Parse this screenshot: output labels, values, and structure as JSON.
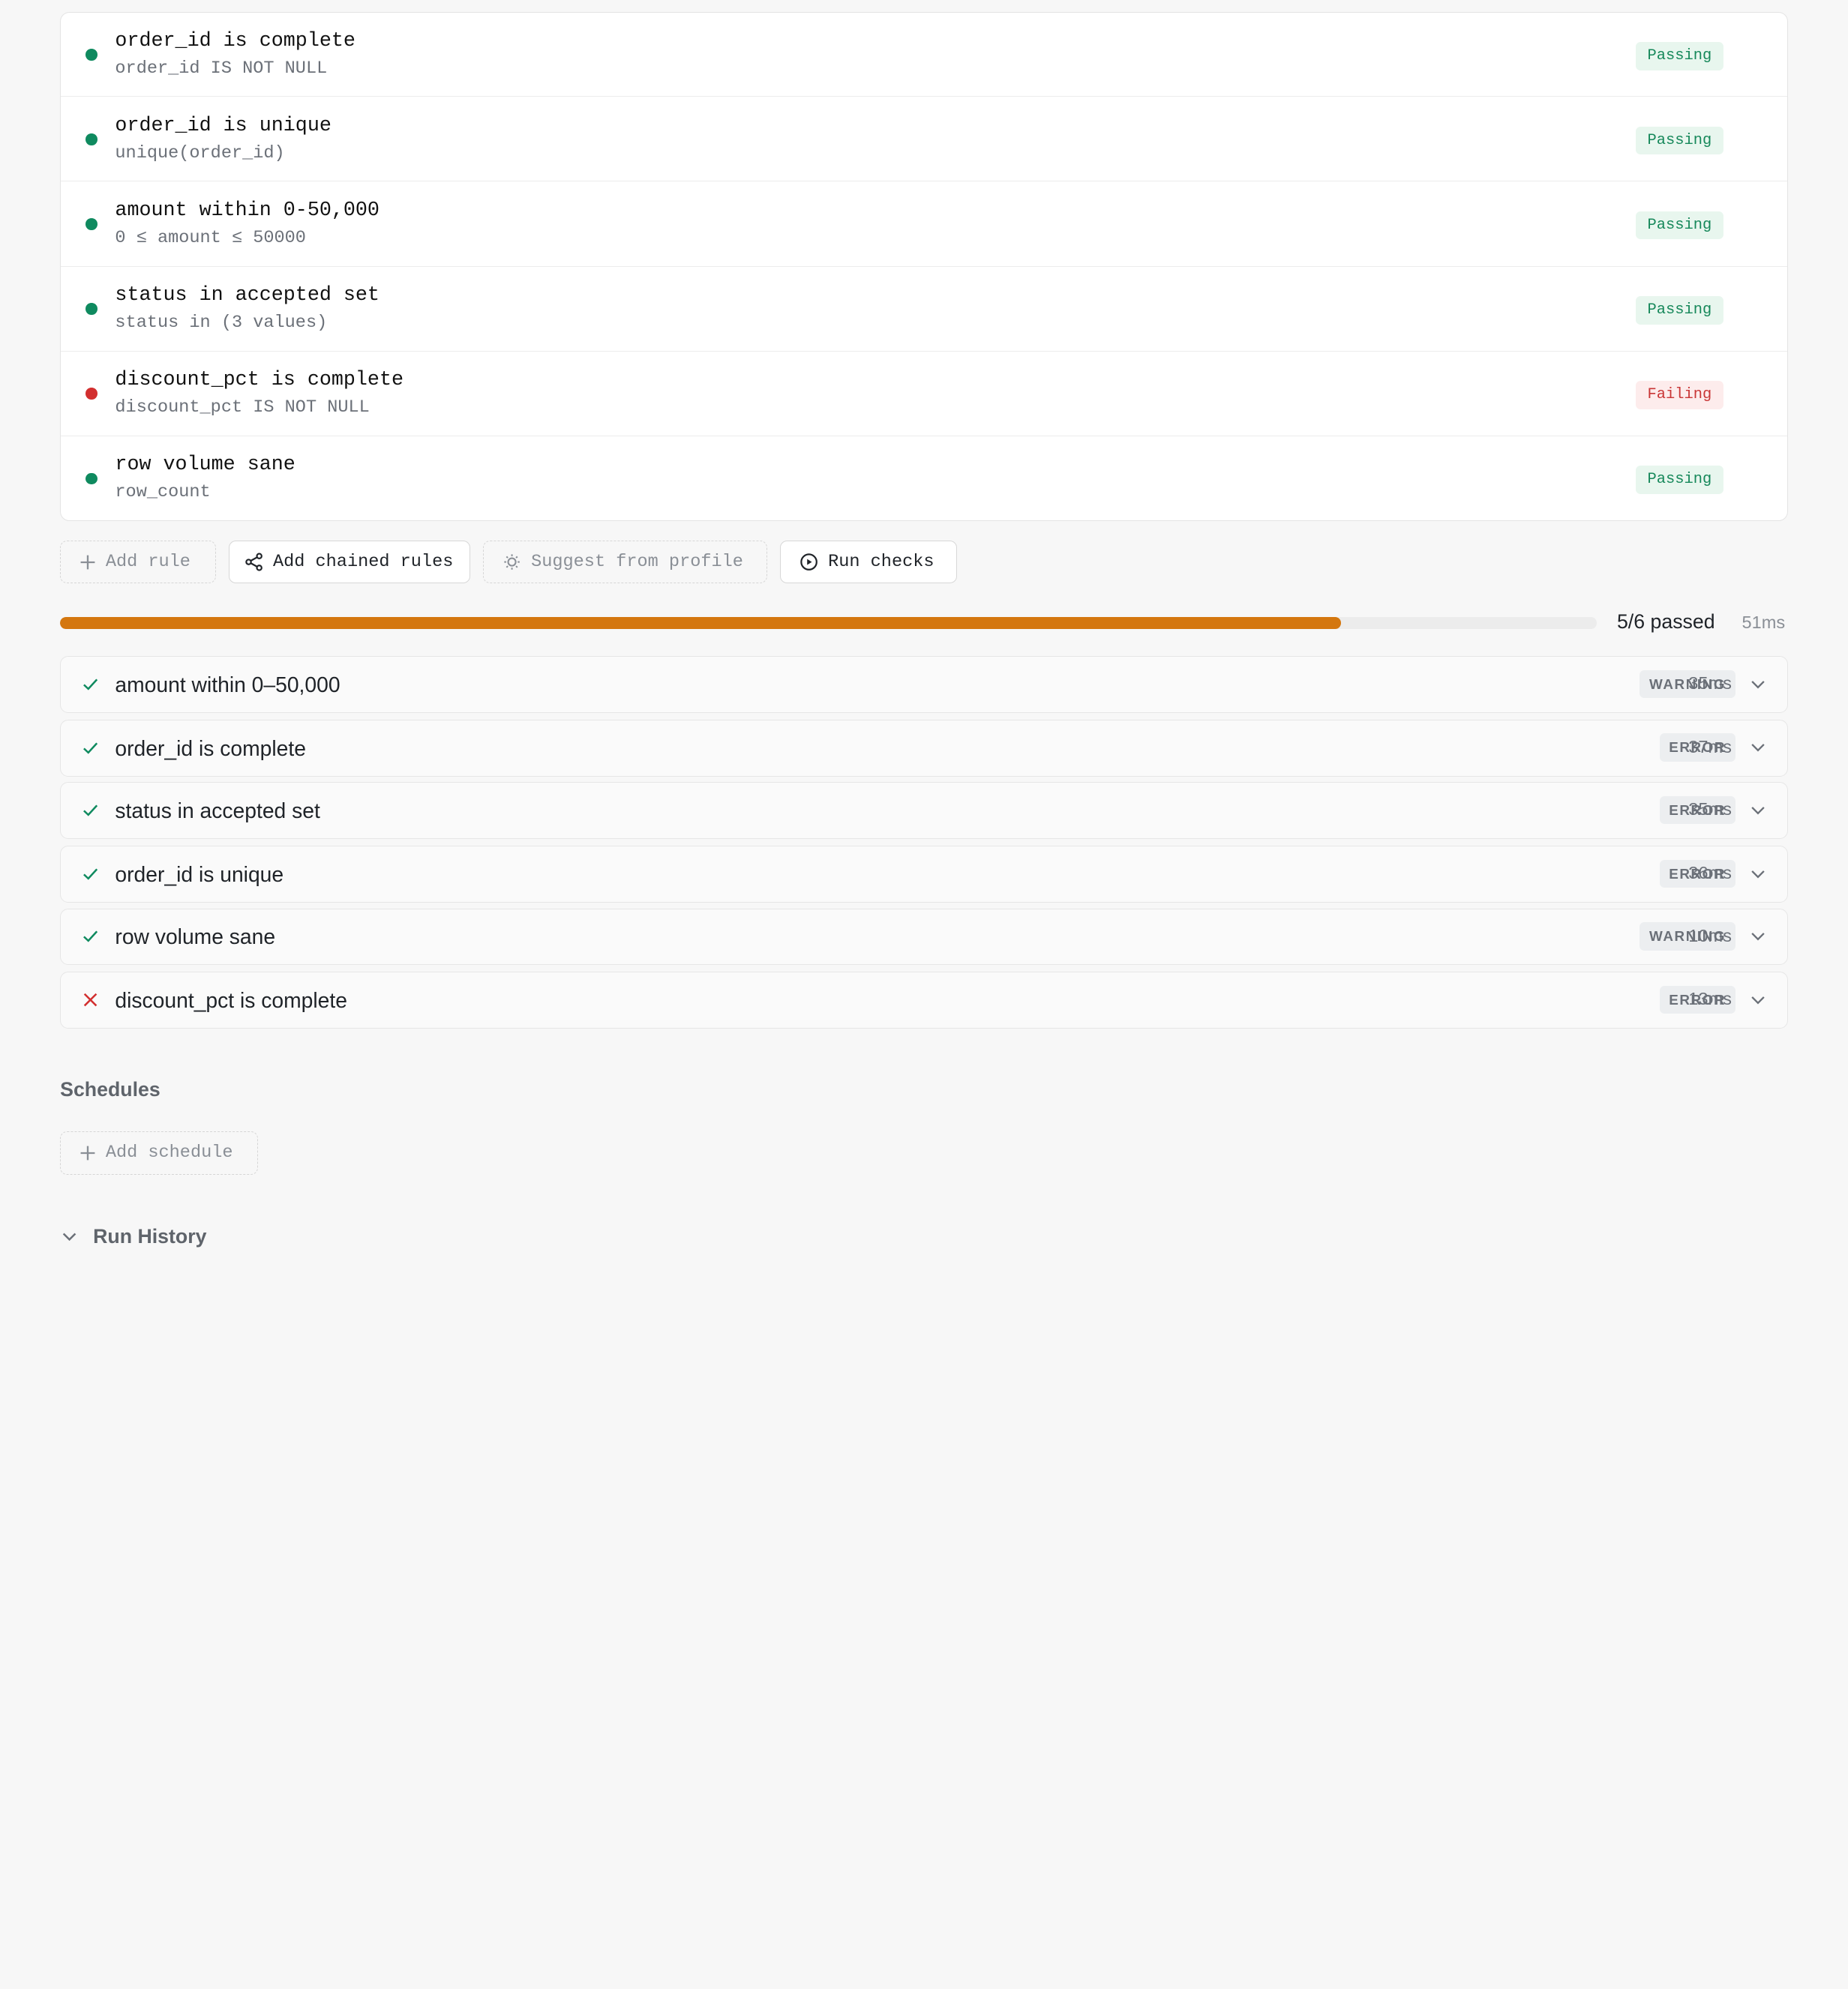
{
  "rules": [
    {
      "title": "order_id is complete",
      "expr": "order_id IS NOT NULL",
      "status": "Passing",
      "state": "pass"
    },
    {
      "title": "order_id is unique",
      "expr": "unique(order_id)",
      "status": "Passing",
      "state": "pass"
    },
    {
      "title": "amount within 0-50,000",
      "expr": "0 ≤ amount ≤ 50000",
      "status": "Passing",
      "state": "pass"
    },
    {
      "title": "status in accepted set",
      "expr": "status in (3 values)",
      "status": "Passing",
      "state": "pass"
    },
    {
      "title": "discount_pct is complete",
      "expr": "discount_pct IS NOT NULL",
      "status": "Failing",
      "state": "fail"
    },
    {
      "title": "row volume sane",
      "expr": "row_count",
      "status": "Passing",
      "state": "pass"
    }
  ],
  "toolbar": {
    "add_rule": "Add rule",
    "add_chained": "Add chained rules",
    "suggest": "Suggest from profile",
    "run": "Run checks"
  },
  "progress": {
    "label": "5/6 passed",
    "time": "51ms",
    "fraction": 0.8333
  },
  "results": [
    {
      "title": "amount within 0–50,000",
      "severity": "WARNING",
      "time": "35ms",
      "passed": true
    },
    {
      "title": "order_id is complete",
      "severity": "ERROR",
      "time": "37ms",
      "passed": true
    },
    {
      "title": "status in accepted set",
      "severity": "ERROR",
      "time": "35ms",
      "passed": true
    },
    {
      "title": "order_id is unique",
      "severity": "ERROR",
      "time": "36ms",
      "passed": true
    },
    {
      "title": "row volume sane",
      "severity": "WARNING",
      "time": "10ms",
      "passed": true
    },
    {
      "title": "discount_pct is complete",
      "severity": "ERROR",
      "time": "13ms",
      "passed": false
    }
  ],
  "schedules": {
    "title": "Schedules",
    "add_label": "Add schedule"
  },
  "history": {
    "title": "Run History"
  },
  "colors": {
    "pass": "#0f8a5f",
    "fail": "#d22f2f",
    "progress": "#d4770f"
  }
}
